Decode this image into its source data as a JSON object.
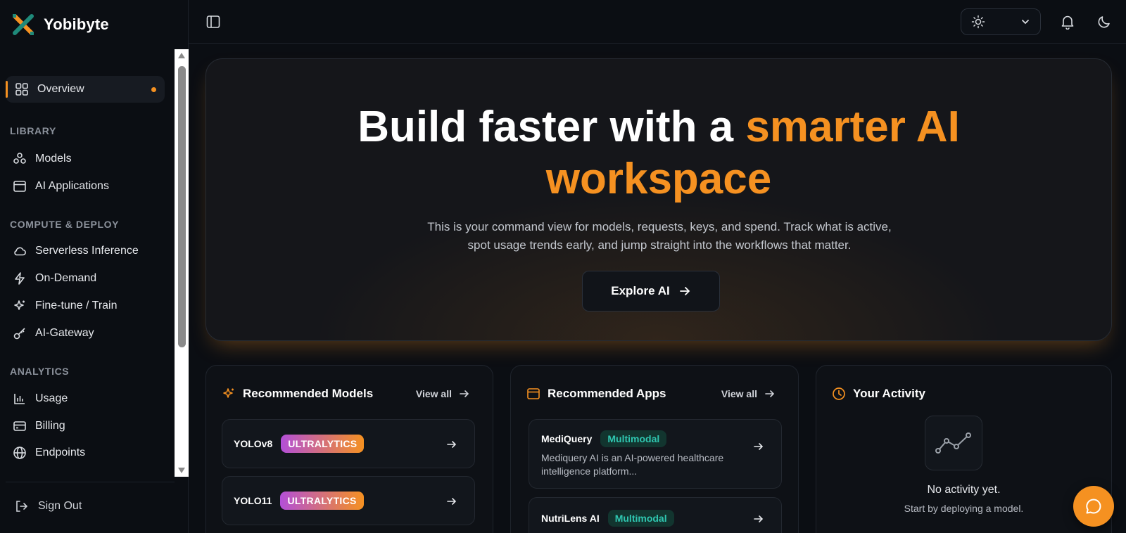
{
  "brand": {
    "name": "Yobibyte",
    "logo_icon": "x-cross-logo"
  },
  "sidebar": {
    "overview": {
      "label": "Overview",
      "icon": "grid-icon"
    },
    "sections": {
      "library": "LIBRARY",
      "compute": "COMPUTE & DEPLOY",
      "analytics": "ANALYTICS"
    },
    "items": [
      {
        "label": "Models",
        "icon": "network-icon"
      },
      {
        "label": "AI Applications",
        "icon": "window-icon"
      },
      {
        "label": "Serverless Inference",
        "icon": "cloud-icon"
      },
      {
        "label": "On-Demand",
        "icon": "lightning-icon"
      },
      {
        "label": "Fine-tune / Train",
        "icon": "sparkle-icon"
      },
      {
        "label": "AI-Gateway",
        "icon": "key-icon"
      },
      {
        "label": "Usage",
        "icon": "bar-chart-icon"
      },
      {
        "label": "Billing",
        "icon": "credit-card-icon"
      },
      {
        "label": "Endpoints",
        "icon": "globe-icon"
      }
    ],
    "sign_out": "Sign Out"
  },
  "topbar": {
    "theme_icon": "sun-icon"
  },
  "hero": {
    "title_prefix": "Build faster with a ",
    "title_accent_1": "smarter AI",
    "title_accent_2": "workspace",
    "description": "This is your command view for models, requests, keys, and spend. Track what is active, spot usage trends early, and jump straight into the workflows that matter.",
    "button_label": "Explore AI"
  },
  "recommended_models": {
    "title": "Recommended Models",
    "view_all": "View all",
    "items": [
      {
        "name": "YOLOv8",
        "badge": "ULTRALYTICS"
      },
      {
        "name": "YOLO11",
        "badge": "ULTRALYTICS"
      }
    ]
  },
  "recommended_apps": {
    "title": "Recommended Apps",
    "view_all": "View all",
    "items": [
      {
        "name": "MediQuery",
        "badge": "Multimodal",
        "description": "Mediquery AI is an AI-powered healthcare intelligence platform..."
      },
      {
        "name": "NutriLens AI",
        "badge": "Multimodal"
      }
    ]
  },
  "activity": {
    "title": "Your Activity",
    "empty": "No activity yet.",
    "hint": "Start by deploying a model."
  },
  "colors": {
    "accent": "#f59121",
    "background": "#0b0e13",
    "teal": "#2fc6b0"
  }
}
